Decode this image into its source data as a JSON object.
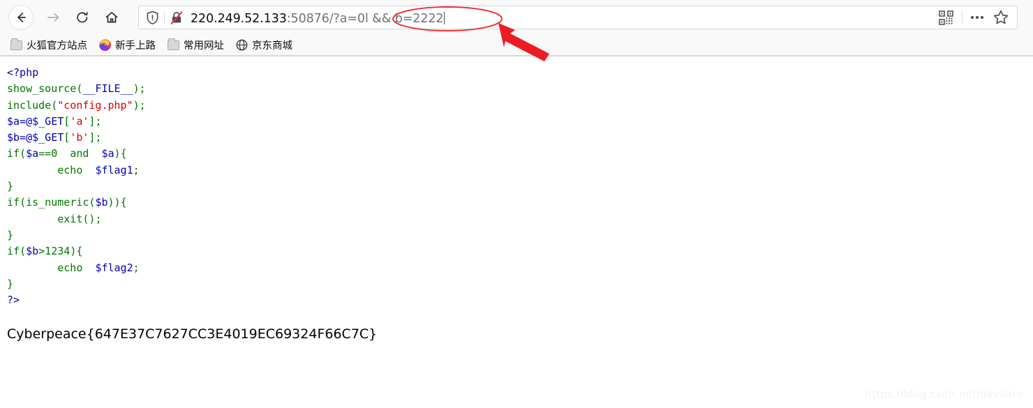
{
  "browser": {
    "nav": {
      "back_label": "Back",
      "forward_label": "Forward",
      "reload_label": "Reload",
      "home_label": "Home"
    },
    "urlbar": {
      "host": "220.249.52.133",
      "port": ":50876",
      "path": "/?a=0l && b=2222",
      "full_url": "220.249.52.133:50876/?a=0l && b=2222",
      "shield_icon": "shield-icon",
      "lock_icon": "lock-crossed-insecure-icon",
      "qr_icon": "qr-code-icon",
      "more_icon": "page-actions-ellipsis-icon",
      "bookmark_icon": "star-bookmark-icon"
    },
    "bookmarks": [
      {
        "label": "火狐官方站点",
        "icon": "folder-icon"
      },
      {
        "label": "新手上路",
        "icon": "firefox-logo-icon"
      },
      {
        "label": "常用网址",
        "icon": "folder-icon"
      },
      {
        "label": "京东商城",
        "icon": "globe-icon"
      }
    ]
  },
  "page": {
    "code_lines": [
      [
        {
          "t": "<?php",
          "c": "k"
        }
      ],
      [
        {
          "t": "show_source",
          "c": "f"
        },
        {
          "t": "(",
          "c": "f"
        },
        {
          "t": "__FILE__",
          "c": "k"
        },
        {
          "t": ")",
          "c": "f"
        },
        {
          "t": ";",
          "c": "f"
        }
      ],
      [
        {
          "t": "include",
          "c": "f"
        },
        {
          "t": "(",
          "c": "f"
        },
        {
          "t": "\"config.php\"",
          "c": "s"
        },
        {
          "t": ")",
          "c": "f"
        },
        {
          "t": ";",
          "c": "f"
        }
      ],
      [
        {
          "t": "$a=@$_GET",
          "c": "v"
        },
        {
          "t": "[",
          "c": "f"
        },
        {
          "t": "'a'",
          "c": "s"
        },
        {
          "t": "]",
          "c": "f"
        },
        {
          "t": ";",
          "c": "f"
        }
      ],
      [
        {
          "t": "$b=@$_GET",
          "c": "v"
        },
        {
          "t": "[",
          "c": "f"
        },
        {
          "t": "'b'",
          "c": "s"
        },
        {
          "t": "]",
          "c": "f"
        },
        {
          "t": ";",
          "c": "f"
        }
      ],
      [
        {
          "t": "if",
          "c": "f"
        },
        {
          "t": "(",
          "c": "f"
        },
        {
          "t": "$a",
          "c": "v"
        },
        {
          "t": "==0",
          "c": "f"
        },
        {
          "t": "  ",
          "c": "f"
        },
        {
          "t": "and",
          "c": "f"
        },
        {
          "t": "  ",
          "c": "f"
        },
        {
          "t": "$a",
          "c": "v"
        },
        {
          "t": ")",
          "c": "f"
        },
        {
          "t": "{",
          "c": "f"
        }
      ],
      [
        {
          "t": "        ",
          "c": "f"
        },
        {
          "t": "echo",
          "c": "f"
        },
        {
          "t": "  ",
          "c": "f"
        },
        {
          "t": "$flag1",
          "c": "v"
        },
        {
          "t": ";",
          "c": "f"
        }
      ],
      [
        {
          "t": "}",
          "c": "f"
        }
      ],
      [
        {
          "t": "if",
          "c": "f"
        },
        {
          "t": "(",
          "c": "f"
        },
        {
          "t": "is_numeric",
          "c": "f"
        },
        {
          "t": "(",
          "c": "f"
        },
        {
          "t": "$b",
          "c": "v"
        },
        {
          "t": "))",
          "c": "f"
        },
        {
          "t": "{",
          "c": "f"
        }
      ],
      [
        {
          "t": "        ",
          "c": "f"
        },
        {
          "t": "exit",
          "c": "f"
        },
        {
          "t": "()",
          "c": "f"
        },
        {
          "t": ";",
          "c": "f"
        }
      ],
      [
        {
          "t": "}",
          "c": "f"
        }
      ],
      [
        {
          "t": "if",
          "c": "f"
        },
        {
          "t": "(",
          "c": "f"
        },
        {
          "t": "$b",
          "c": "v"
        },
        {
          "t": ">1234",
          "c": "f"
        },
        {
          "t": ")",
          "c": "f"
        },
        {
          "t": "{",
          "c": "f"
        }
      ],
      [
        {
          "t": "        ",
          "c": "f"
        },
        {
          "t": "echo",
          "c": "f"
        },
        {
          "t": "  ",
          "c": "f"
        },
        {
          "t": "$flag2",
          "c": "v"
        },
        {
          "t": ";",
          "c": "f"
        }
      ],
      [
        {
          "t": "}",
          "c": "f"
        }
      ],
      [
        {
          "t": "?>",
          "c": "k"
        }
      ]
    ],
    "flag_text": "Cyberpeace{647E37C7627CC3E4019EC69324F66C7C}",
    "watermark": "https://blog.csdn.net/devilare"
  },
  "annotations": {
    "ellipse_label": "red-ellipse-highlight-query-string",
    "arrow_label": "red-arrow-pointing-to-query-string",
    "color": "#f03030"
  }
}
